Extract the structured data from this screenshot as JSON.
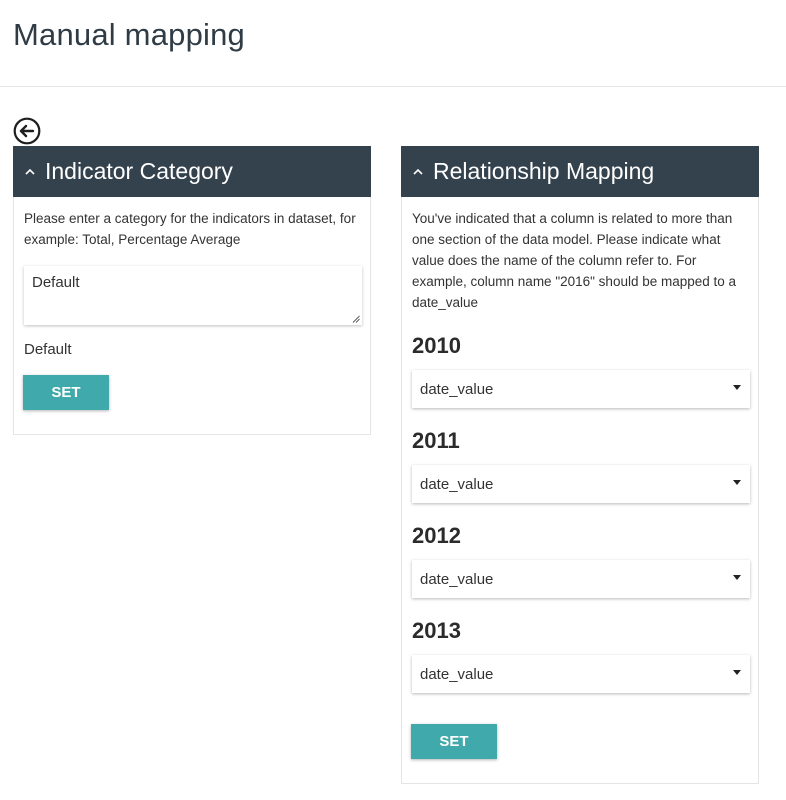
{
  "page": {
    "title": "Manual mapping"
  },
  "back": {
    "icon": "arrow-left-circle-icon"
  },
  "indicator_category": {
    "title": "Indicator Category",
    "description": "Please enter a category for the indicators in dataset, for example: Total, Percentage Average",
    "input_value": "Default",
    "current_value": "Default",
    "set_label": "SET"
  },
  "relationship_mapping": {
    "title": "Relationship Mapping",
    "description": "You've indicated that a column is related to more than one section of the data model. Please indicate what value does the name of the column refer to. For example, column name \"2016\" should be mapped to a date_value",
    "rows": [
      {
        "year": "2010",
        "selected": "date_value"
      },
      {
        "year": "2011",
        "selected": "date_value"
      },
      {
        "year": "2012",
        "selected": "date_value"
      },
      {
        "year": "2013",
        "selected": "date_value"
      }
    ],
    "set_label": "SET"
  },
  "colors": {
    "panel_header": "#34424e",
    "accent_button": "#3fa9ab",
    "title_text": "#2f3b45"
  }
}
